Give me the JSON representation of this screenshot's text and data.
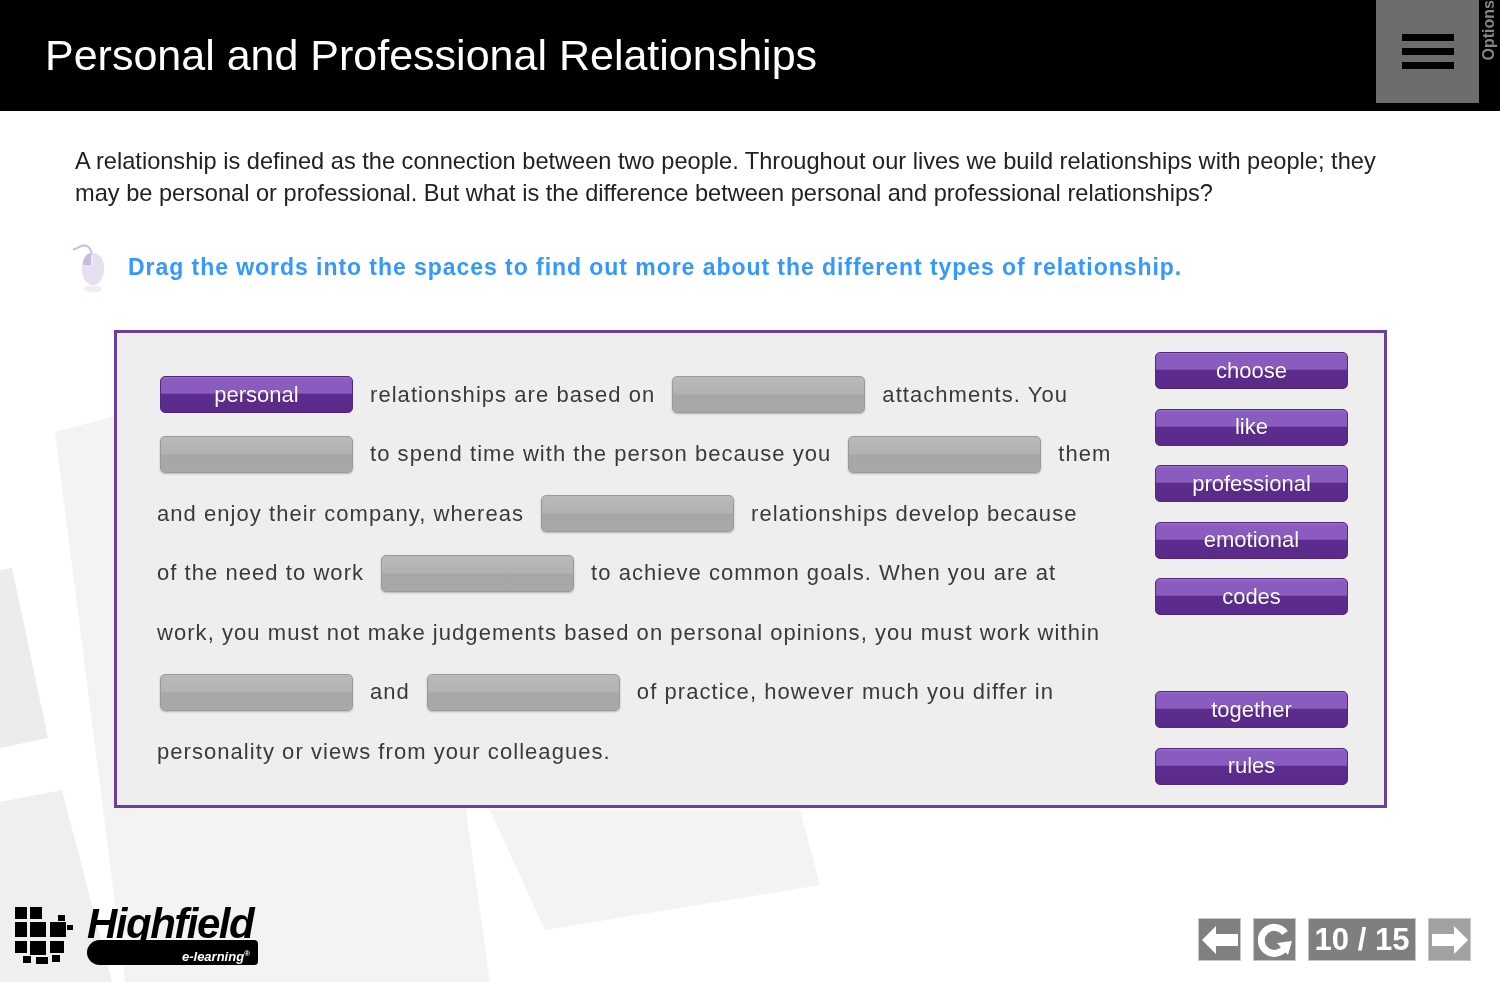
{
  "header": {
    "title": "Personal and Professional Relationships",
    "options_label": "Options"
  },
  "intro": "A relationship is defined as the connection between two people. Throughout our lives we build relationships with people; they may be personal or professional. But what is the difference between personal and professional relationships?",
  "instruction": "Drag the words into the spaces to find out more about the different types of relationship.",
  "exercise": {
    "lines": [
      [
        {
          "kind": "blank",
          "filled": true,
          "word": "personal"
        },
        {
          "kind": "text",
          "text": "relationships are based on"
        },
        {
          "kind": "blank",
          "filled": false
        },
        {
          "kind": "text",
          "text": "attachments. You"
        }
      ],
      [
        {
          "kind": "blank",
          "filled": false
        },
        {
          "kind": "text",
          "text": "to spend time with the person because you"
        },
        {
          "kind": "blank",
          "filled": false
        },
        {
          "kind": "text",
          "text": "them"
        }
      ],
      [
        {
          "kind": "text",
          "text": "and enjoy their company, whereas"
        },
        {
          "kind": "blank",
          "filled": false
        },
        {
          "kind": "text",
          "text": "relationships develop because"
        }
      ],
      [
        {
          "kind": "text",
          "text": "of the need to work"
        },
        {
          "kind": "blank",
          "filled": false
        },
        {
          "kind": "text",
          "text": "to achieve common goals. When you are at"
        }
      ],
      [
        {
          "kind": "text",
          "text": "work, you must not make judgements based on personal opinions, you must work within"
        }
      ],
      [
        {
          "kind": "blank",
          "filled": false
        },
        {
          "kind": "text",
          "text": "and"
        },
        {
          "kind": "blank",
          "filled": false
        },
        {
          "kind": "text",
          "text": "of practice, however much you differ in"
        }
      ],
      [
        {
          "kind": "text",
          "text": "personality or views from your colleagues."
        }
      ]
    ],
    "word_bank": [
      {
        "empty": false,
        "word": "choose"
      },
      {
        "empty": false,
        "word": "like"
      },
      {
        "empty": false,
        "word": "professional"
      },
      {
        "empty": false,
        "word": "emotional"
      },
      {
        "empty": false,
        "word": "codes"
      },
      {
        "empty": true
      },
      {
        "empty": false,
        "word": "together"
      },
      {
        "empty": false,
        "word": "rules"
      }
    ]
  },
  "footer": {
    "logo": {
      "name": "Highfield",
      "tagline": "e-learning$^{®}$"
    },
    "page_counter": "10 / 15",
    "next_disabled": true
  }
}
